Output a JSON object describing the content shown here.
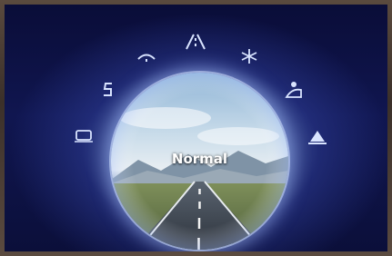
{
  "mode_selector": {
    "current_mode": "Normal",
    "icons": [
      "road-mode-icon",
      "rain-wiper-icon",
      "snowflake-icon",
      "slope-icon",
      "tire-icon",
      "sport-icon",
      "eco-icon",
      "lock-icon"
    ]
  }
}
